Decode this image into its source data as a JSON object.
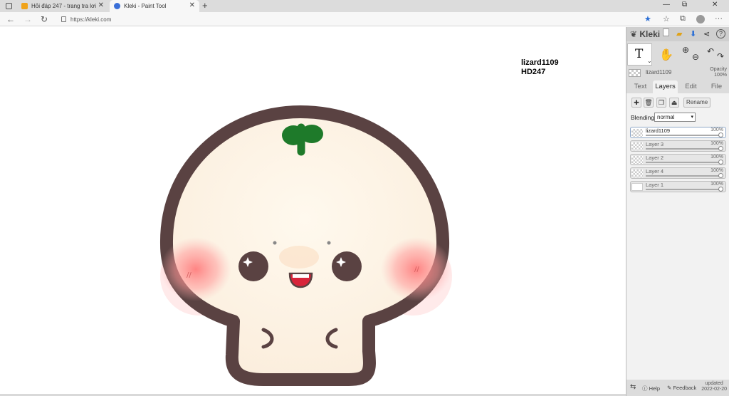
{
  "browser": {
    "tabs": [
      {
        "title": "Hỏi đáp 247 - trang tra lơi",
        "active": false,
        "favicon_color": "#f0a31a"
      },
      {
        "title": "Kleki - Paint Tool",
        "active": true,
        "favicon_color": "#3a6fd8"
      }
    ],
    "url": "https://kleki.com",
    "icons": {
      "back": "arrow-left-icon",
      "forward": "arrow-right-icon",
      "refresh": "refresh-icon",
      "favorite": "star-icon",
      "collections": "collections-icon",
      "extensions": "extensions-icon",
      "profile": "profile-icon",
      "menu": "ellipsis-icon"
    }
  },
  "canvas": {
    "text_lines": [
      "lizard1109",
      "HD247"
    ]
  },
  "panel": {
    "logo": "Kleki",
    "header_icons": [
      "new-image-icon",
      "open-folder-icon",
      "save-icon",
      "share-icon",
      "help-icon"
    ],
    "tool": {
      "current": "T"
    },
    "color": {
      "name": "lizard1109"
    },
    "opacity": {
      "label": "Opacity",
      "value": "100%"
    },
    "tabs": [
      {
        "label": "Text",
        "active": false
      },
      {
        "label": "Layers",
        "active": true
      },
      {
        "label": "Edit",
        "active": false
      },
      {
        "label": "File",
        "active": false
      }
    ],
    "rename_label": "Rename",
    "blending": {
      "label": "Blending",
      "value": "normal"
    },
    "layers": [
      {
        "name": "lizard1109",
        "opacity": "100%",
        "selected": true
      },
      {
        "name": "Layer 3",
        "opacity": "100%",
        "selected": false
      },
      {
        "name": "Layer 2",
        "opacity": "100%",
        "selected": false
      },
      {
        "name": "Layer 4",
        "opacity": "100%",
        "selected": false
      },
      {
        "name": "Layer 1",
        "opacity": "100%",
        "selected": false
      }
    ],
    "footer": {
      "help": "Help",
      "feedback": "Feedback",
      "updated_label": "updated",
      "updated_date": "2022-02-20"
    }
  },
  "colors": {
    "outline": "#5a4242",
    "face": "#fdf4e6",
    "blush": "#ff8f8f",
    "leaf": "#1e7a2a",
    "panel_bg": "#dcdcdc"
  }
}
